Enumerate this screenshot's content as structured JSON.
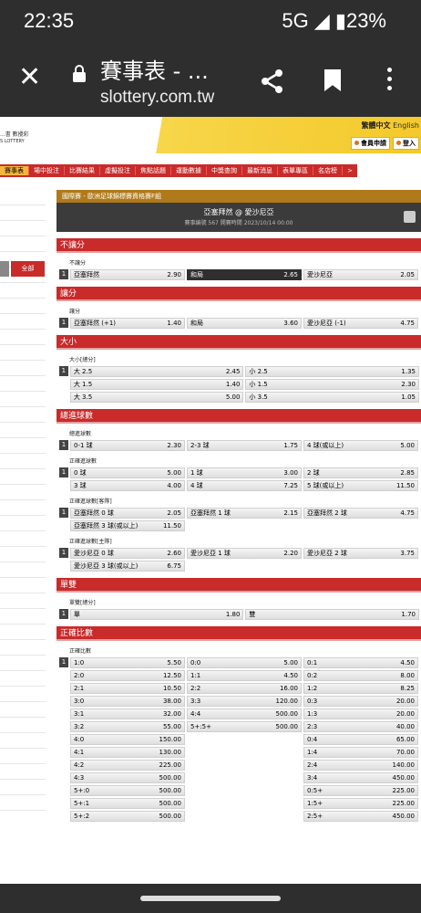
{
  "status": {
    "time": "22:35",
    "network": "5G ◢ ▮23%"
  },
  "browser": {
    "title": "賽事表 - ...",
    "url": "slottery.com.tw"
  },
  "site": {
    "logo_line1": "...書  數攪彩",
    "logo_line2": "S LOTTERY",
    "lang_active": "繁體中文",
    "lang_other": "English",
    "register": "會員申請",
    "login": "登入",
    "nav": [
      "賽事表",
      "場中投注",
      "比賽結果",
      "虛擬投注",
      "焦點話題",
      "運動數據",
      "中獎查詢",
      "最新消息",
      "表單專區",
      "名店榜",
      ">"
    ],
    "side_all": "全部"
  },
  "match": {
    "competition": "國際賽 - 歐洲足球錦標賽資格賽F組",
    "teams": "亞塞拜然 @ 愛沙尼亞",
    "info": "賽事編號 567 開賽時間 2023/10/14 00:00"
  },
  "sections": [
    {
      "title": "不讓分",
      "groups": [
        {
          "label": "不讓分",
          "num": "1",
          "rows": [
            [
              [
                "亞塞拜然",
                "2.90"
              ],
              [
                "和局",
                "2.65",
                "dark"
              ],
              [
                "愛沙尼亞",
                "2.05"
              ]
            ]
          ]
        }
      ]
    },
    {
      "title": "讓分",
      "groups": [
        {
          "label": "讓分",
          "num": "1",
          "rows": [
            [
              [
                "亞塞拜然 (+1)",
                "1.40"
              ],
              [
                "和局",
                "3.60"
              ],
              [
                "愛沙尼亞 (-1)",
                "4.75"
              ]
            ]
          ]
        }
      ]
    },
    {
      "title": "大小",
      "groups": [
        {
          "label": "大小[總分]",
          "num": "1",
          "rows": [
            [
              [
                "大 2.5",
                "2.45"
              ],
              [
                "小 2.5",
                "1.35"
              ]
            ],
            [
              [
                "大 1.5",
                "1.40"
              ],
              [
                "小 1.5",
                "2.30"
              ]
            ],
            [
              [
                "大 3.5",
                "5.00"
              ],
              [
                "小 3.5",
                "1.05"
              ]
            ]
          ]
        }
      ]
    },
    {
      "title": "總進球數",
      "groups": [
        {
          "label": "總進球數",
          "num": "1",
          "rows": [
            [
              [
                "0-1 球",
                "2.30"
              ],
              [
                "2-3 球",
                "1.75"
              ],
              [
                "4 球(或以上)",
                "5.00"
              ]
            ]
          ]
        },
        {
          "label": "正確進球數",
          "num": "1",
          "rows": [
            [
              [
                "0 球",
                "5.00"
              ],
              [
                "1 球",
                "3.00"
              ],
              [
                "2 球",
                "2.85"
              ]
            ],
            [
              [
                "3 球",
                "4.00"
              ],
              [
                "4 球",
                "7.25"
              ],
              [
                "5 球(或以上)",
                "11.50"
              ]
            ]
          ]
        },
        {
          "label": "正確進球數[客隊]",
          "num": "1",
          "rows": [
            [
              [
                "亞塞拜然 0 球",
                "2.05"
              ],
              [
                "亞塞拜然 1 球",
                "2.15"
              ],
              [
                "亞塞拜然 2 球",
                "4.75"
              ]
            ],
            [
              [
                "亞塞拜然 3 球(或以上)",
                "11.50"
              ]
            ]
          ]
        },
        {
          "label": "正確進球數[主隊]",
          "num": "1",
          "rows": [
            [
              [
                "愛沙尼亞 0 球",
                "2.60"
              ],
              [
                "愛沙尼亞 1 球",
                "2.20"
              ],
              [
                "愛沙尼亞 2 球",
                "3.75"
              ]
            ],
            [
              [
                "愛沙尼亞 3 球(或以上)",
                "6.75"
              ]
            ]
          ]
        }
      ]
    },
    {
      "title": "單雙",
      "groups": [
        {
          "label": "單雙[總分]",
          "num": "1",
          "rows": [
            [
              [
                "單",
                "1.80"
              ],
              [
                "雙",
                "1.70"
              ]
            ]
          ]
        }
      ]
    },
    {
      "title": "正確比數",
      "groups": [
        {
          "label": "正確比數",
          "num": "1",
          "rows": [
            [
              [
                "1:0",
                "5.50"
              ],
              [
                "0:0",
                "5.00"
              ],
              [
                "0:1",
                "4.50"
              ]
            ],
            [
              [
                "2:0",
                "12.50"
              ],
              [
                "1:1",
                "4.50"
              ],
              [
                "0:2",
                "8.00"
              ]
            ],
            [
              [
                "2:1",
                "10.50"
              ],
              [
                "2:2",
                "16.00"
              ],
              [
                "1:2",
                "8.25"
              ]
            ],
            [
              [
                "3:0",
                "38.00"
              ],
              [
                "3:3",
                "120.00"
              ],
              [
                "0:3",
                "20.00"
              ]
            ],
            [
              [
                "3:1",
                "32.00"
              ],
              [
                "4:4",
                "500.00"
              ],
              [
                "1:3",
                "20.00"
              ]
            ],
            [
              [
                "3:2",
                "55.00"
              ],
              [
                "5+:5+",
                "500.00"
              ],
              [
                "2:3",
                "40.00"
              ]
            ],
            [
              [
                "4:0",
                "150.00"
              ],
              null,
              [
                "0:4",
                "65.00"
              ]
            ],
            [
              [
                "4:1",
                "130.00"
              ],
              null,
              [
                "1:4",
                "70.00"
              ]
            ],
            [
              [
                "4:2",
                "225.00"
              ],
              null,
              [
                "2:4",
                "140.00"
              ]
            ],
            [
              [
                "4:3",
                "500.00"
              ],
              null,
              [
                "3:4",
                "450.00"
              ]
            ],
            [
              [
                "5+:0",
                "500.00"
              ],
              null,
              [
                "0:5+",
                "225.00"
              ]
            ],
            [
              [
                "5+:1",
                "500.00"
              ],
              null,
              [
                "1:5+",
                "225.00"
              ]
            ],
            [
              [
                "5+:2",
                "500.00"
              ],
              null,
              [
                "2:5+",
                "450.00"
              ]
            ]
          ]
        }
      ]
    }
  ],
  "colors": {
    "accent_red": "#c92a2a",
    "header_yellow": "#f4c92a",
    "competition_bar": "#b07a1a"
  }
}
